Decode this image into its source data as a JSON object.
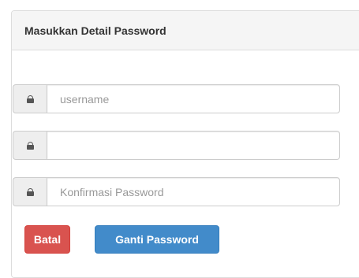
{
  "panel": {
    "title": "Masukkan Detail Password"
  },
  "form": {
    "username": {
      "value": "",
      "placeholder": "username",
      "icon": "lock-icon"
    },
    "password": {
      "value": "",
      "placeholder": "",
      "icon": "lock-icon"
    },
    "confirm_password": {
      "value": "",
      "placeholder": "Konfirmasi Password",
      "icon": "lock-icon"
    }
  },
  "actions": {
    "cancel_label": "Batal",
    "submit_label": "Ganti Password"
  },
  "colors": {
    "danger": "#d9534f",
    "primary": "#428bca",
    "heading_bg": "#f5f5f5"
  }
}
